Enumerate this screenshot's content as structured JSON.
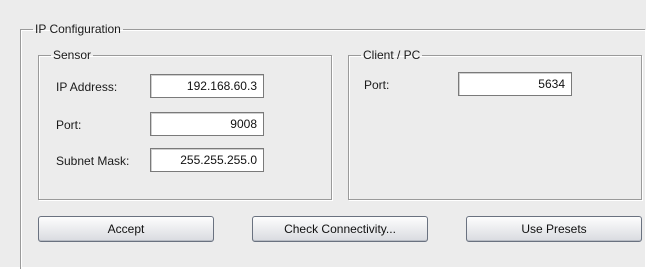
{
  "ip_configuration": {
    "title": "IP Configuration",
    "sensor": {
      "title": "Sensor",
      "ip_address_label": "IP Address:",
      "ip_address_value": "192.168.60.3",
      "port_label": "Port:",
      "port_value": "9008",
      "subnet_mask_label": "Subnet Mask:",
      "subnet_mask_value": "255.255.255.0"
    },
    "client": {
      "title": "Client / PC",
      "port_label": "Port:",
      "port_value": "5634"
    },
    "buttons": {
      "accept": "Accept",
      "check_connectivity": "Check Connectivity...",
      "use_presets": "Use Presets"
    }
  }
}
